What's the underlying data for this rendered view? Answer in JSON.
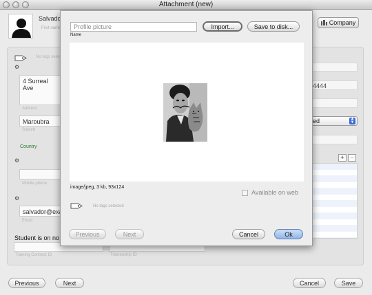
{
  "window": {
    "title": "Attachment  (new)"
  },
  "background": {
    "name_value": "Salvador",
    "name_label": "First name",
    "company_button": "Company",
    "no_tags": "No tags selected",
    "street": "4 Surreal Ave",
    "street_label": "Address",
    "suburb": "Maroubra",
    "suburb_label": "Suburb",
    "country_label": "Country",
    "phone_label": "Mobile phone",
    "email": "salvador@exa",
    "email_label": "Email",
    "student_text": "Student is on no w",
    "contract_label": "Training Contract ID",
    "traineeship_label": "Traineeship ID",
    "phone_number": "4444",
    "status_select": "ed",
    "add_label": "+",
    "remove_label": "−",
    "prev_button": "Previous",
    "next_button": "Next",
    "cancel_button": "Cancel",
    "save_button": "Save"
  },
  "dialog": {
    "name_placeholder": "Profile picture",
    "name_label": "Name",
    "import_button": "Import...",
    "save_to_disk_button": "Save to disk...",
    "file_info": "image/jpeg, 3 kb, 93x124",
    "available_on_web_label": "Available on web",
    "available_on_web_checked": false,
    "no_tags": "No tags selected",
    "prev_button": "Previous",
    "next_button": "Next",
    "cancel_button": "Cancel",
    "ok_button": "Ok"
  },
  "colors": {
    "select_accent": "#3d6bd8",
    "default_button": "#8fb4e8",
    "country_green": "#2a7a2a"
  }
}
